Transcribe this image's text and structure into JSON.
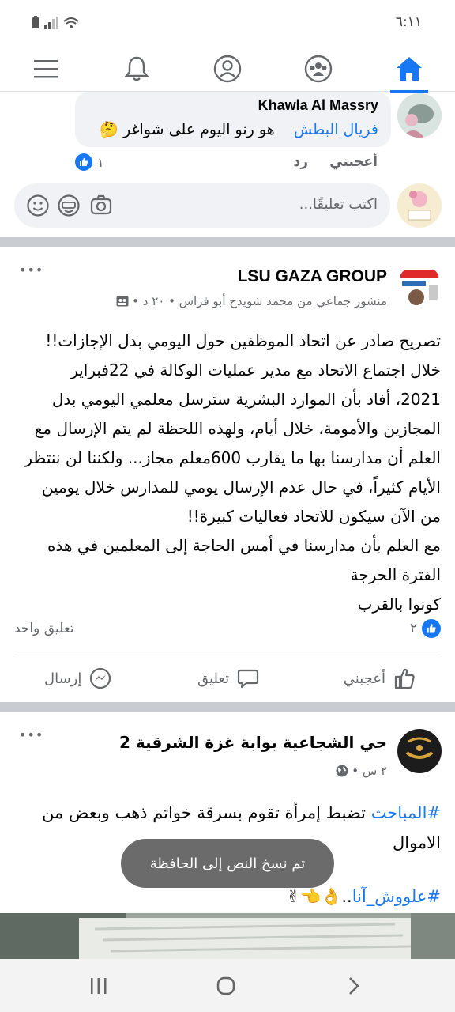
{
  "status_bar": {
    "time": "٦:١١"
  },
  "top_nav": {
    "items": [
      "home-icon",
      "groups-icon",
      "profile-icon",
      "notifications-icon",
      "menu-icon"
    ],
    "active": "home-icon",
    "accent": "#1877f2"
  },
  "comment": {
    "author": "Khawla Al Massry",
    "mention": "فريال البطش",
    "text": "هو رنو اليوم على شواغر",
    "emoji": "🤔",
    "like_label": "أعجبني",
    "reply_label": "رد",
    "reaction_count": "١"
  },
  "comment_input": {
    "placeholder": "اكتب تعليقًا..."
  },
  "post1": {
    "group_name": "LSU GAZA GROUP",
    "meta": "منشور جماعي من محمد شويدح أبو فراس • ٢٠ د •",
    "lines": [
      "تصريح صادر عن اتحاد الموظفين حول اليومي بدل الإجازات!!",
      "خلال اجتماع الاتحاد مع مدير عمليات الوكالة في 22فبراير",
      "2021، أفاد بأن الموارد البشرية سترسل معلمي اليومي بدل",
      "المجازين والأمومة، خلال أيام، ولهذه اللحظة لم يتم الإرسال مع",
      "العلم أن مدارسنا بها ما يقارب 600معلم مجاز... ولكننا لن ننتظر",
      "الأيام كثيراً، في حال عدم الإرسال يومي للمدارس خلال يومين",
      "من الآن سيكون للاتحاد فعاليات كبيرة!!",
      "مع العلم بأن مدارسنا في أمس الحاجة إلى المعلمين في هذه",
      "الفترة الحرجة",
      "كونوا بالقرب"
    ],
    "reaction_count": "٢",
    "comments_count": "تعليق واحد",
    "actions": {
      "like": "أعجبني",
      "comment": "تعليق",
      "send": "إرسال"
    }
  },
  "post2": {
    "page_name": "حي الشجاعية بوابة غزة الشرقية 2",
    "meta": "٢ س •",
    "hashtag1": "#المباحث",
    "line1_rest": " تضبط إمرأة تقوم بسرقة خواتم ذهب وبعض من",
    "line2": "الاموال",
    "hashtag2": "#علووش_آنا",
    "line3_rest": "..",
    "emojis": "👌👈✌"
  },
  "toast": {
    "text": "تم نسخ النص إلى الحافظة"
  },
  "more_label": "•••"
}
